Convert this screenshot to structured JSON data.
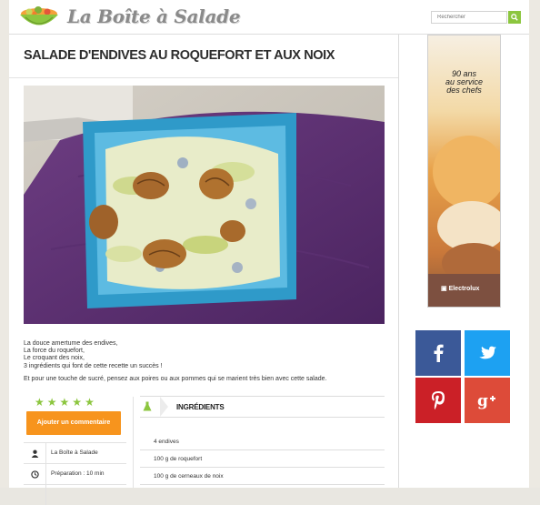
{
  "header": {
    "logo_text": "La Boîte à Salade",
    "search_placeholder": "Rechercher"
  },
  "recipe": {
    "title": "SALADE D'ENDIVES AU ROQUEFORT ET AUX NOIX",
    "intro_lines": [
      "La douce amertume des endives,",
      "La force du roquefort,",
      "Le croquant des noix,",
      "3 ingrédients qui font de cette recette un succès !"
    ],
    "intro_second": "Et pour une touche de sucré, pensez aux poires ou aux pommes qui se marient très bien avec cette salade.",
    "rating": 5,
    "comment_button": "Ajouter un commentaire",
    "author": "La Boîte à Salade",
    "prep_label": "Préparation : 10 min"
  },
  "ingredients": {
    "heading": "INGRÉDIENTS",
    "items": [
      "4 endives",
      "100 g de roquefort",
      "100 g de cerneaux de noix"
    ]
  },
  "ad": {
    "line1": "90 ans",
    "line2": "au service",
    "line3": "des chefs",
    "brand": "Electrolux"
  },
  "social": {
    "facebook": "facebook-icon",
    "twitter": "twitter-icon",
    "pinterest": "pinterest-icon",
    "googleplus": "googleplus-icon"
  },
  "colors": {
    "accent_green": "#8cc63f",
    "button_orange": "#f7941d",
    "facebook": "#3b5998",
    "twitter": "#1da1f2",
    "pinterest": "#cb2027",
    "googleplus": "#dd4b39"
  }
}
